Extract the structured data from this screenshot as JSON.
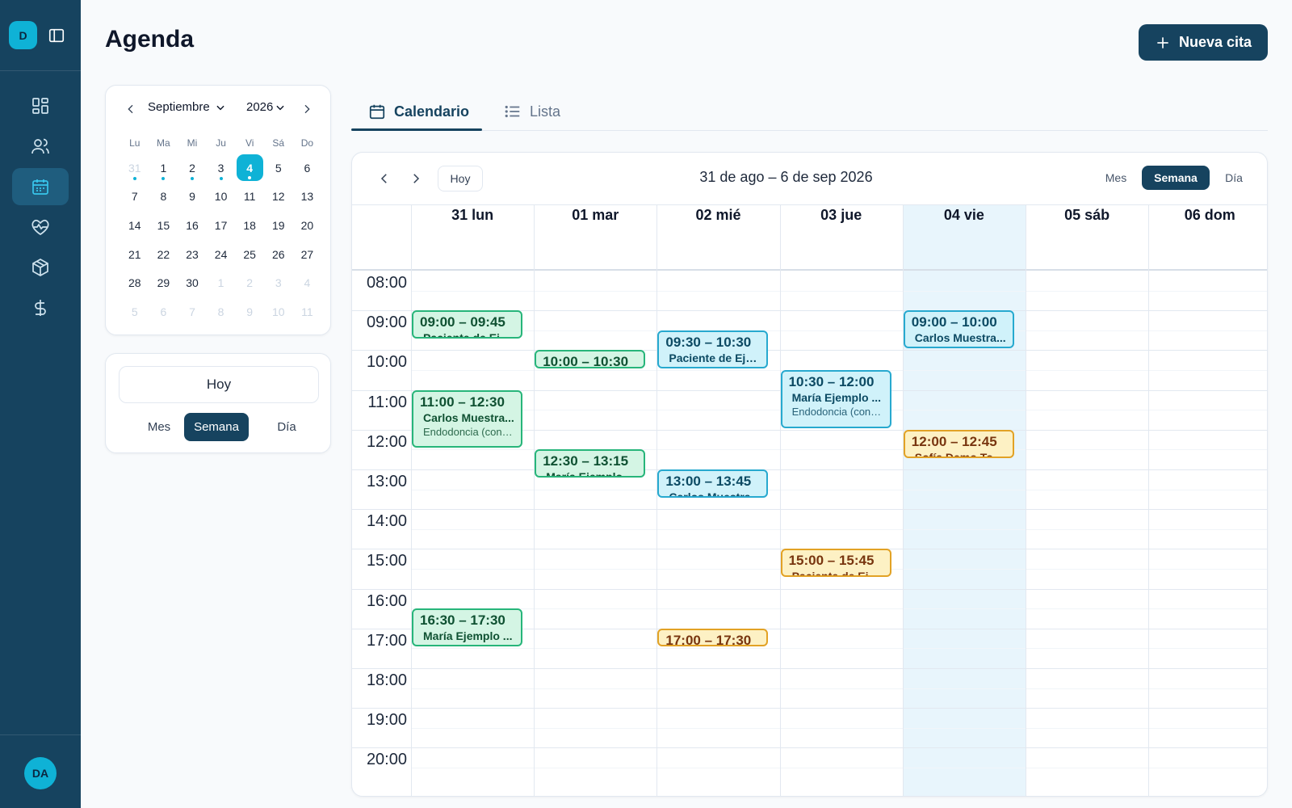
{
  "sidebar": {
    "workspace_initial": "D",
    "user_initials": "DA",
    "nav": [
      {
        "icon": "dashboard-icon",
        "active": false
      },
      {
        "icon": "users-icon",
        "active": false
      },
      {
        "icon": "calendar-icon",
        "active": true
      },
      {
        "icon": "heart-pulse-icon",
        "active": false
      },
      {
        "icon": "box-icon",
        "active": false
      },
      {
        "icon": "dollar-icon",
        "active": false
      }
    ]
  },
  "header": {
    "title": "Agenda",
    "new_button": "Nueva cita"
  },
  "mini_calendar": {
    "month": "Septiembre",
    "year": "2026",
    "weekdays": [
      "Lu",
      "Ma",
      "Mi",
      "Ju",
      "Vi",
      "Sá",
      "Do"
    ],
    "days": [
      {
        "n": "31",
        "muted": true,
        "dot": true
      },
      {
        "n": "1",
        "dot": true
      },
      {
        "n": "2",
        "dot": true
      },
      {
        "n": "3",
        "dot": true
      },
      {
        "n": "4",
        "dot": true,
        "selected": true
      },
      {
        "n": "5"
      },
      {
        "n": "6"
      },
      {
        "n": "7"
      },
      {
        "n": "8"
      },
      {
        "n": "9"
      },
      {
        "n": "10"
      },
      {
        "n": "11"
      },
      {
        "n": "12"
      },
      {
        "n": "13"
      },
      {
        "n": "14"
      },
      {
        "n": "15"
      },
      {
        "n": "16"
      },
      {
        "n": "17"
      },
      {
        "n": "18"
      },
      {
        "n": "19"
      },
      {
        "n": "20"
      },
      {
        "n": "21"
      },
      {
        "n": "22"
      },
      {
        "n": "23"
      },
      {
        "n": "24"
      },
      {
        "n": "25"
      },
      {
        "n": "26"
      },
      {
        "n": "27"
      },
      {
        "n": "28"
      },
      {
        "n": "29"
      },
      {
        "n": "30"
      },
      {
        "n": "1",
        "muted": true
      },
      {
        "n": "2",
        "muted": true
      },
      {
        "n": "3",
        "muted": true
      },
      {
        "n": "4",
        "muted": true
      },
      {
        "n": "5",
        "muted": true
      },
      {
        "n": "6",
        "muted": true
      },
      {
        "n": "7",
        "muted": true
      },
      {
        "n": "8",
        "muted": true
      },
      {
        "n": "9",
        "muted": true
      },
      {
        "n": "10",
        "muted": true
      },
      {
        "n": "11",
        "muted": true
      }
    ]
  },
  "quick": {
    "today": "Hoy",
    "views": [
      "Mes",
      "Semana",
      "Día"
    ],
    "active_view": "Semana"
  },
  "tabs": [
    {
      "label": "Calendario",
      "active": true,
      "icon": "calendar-icon"
    },
    {
      "label": "Lista",
      "active": false,
      "icon": "list-icon"
    }
  ],
  "calendar": {
    "today_button": "Hoy",
    "range": "31 de ago – 6 de sep 2026",
    "views": [
      "Mes",
      "Semana",
      "Día"
    ],
    "active_view": "Semana",
    "days": [
      {
        "label": "31 lun"
      },
      {
        "label": "01 mar"
      },
      {
        "label": "02 mié"
      },
      {
        "label": "03 jue"
      },
      {
        "label": "04 vie",
        "today": true
      },
      {
        "label": "05 sáb"
      },
      {
        "label": "06 dom"
      }
    ],
    "hours": [
      "08:00",
      "09:00",
      "10:00",
      "11:00",
      "12:00",
      "13:00",
      "14:00",
      "15:00",
      "16:00",
      "17:00",
      "18:00",
      "19:00",
      "20:00"
    ],
    "colors": {
      "green": "#27b57a",
      "cyan": "#27a9cf",
      "amber": "#e2a225"
    },
    "events": [
      {
        "day": 0,
        "start": "09:00",
        "end": "09:45",
        "time": "09:00 – 09:45",
        "patient": "Paciente de Eje...",
        "color": "green"
      },
      {
        "day": 0,
        "start": "11:00",
        "end": "12:30",
        "time": "11:00 – 12:30",
        "patient": "Carlos Muestra...",
        "service": "Endodoncia (cond...",
        "color": "green"
      },
      {
        "day": 0,
        "start": "16:30",
        "end": "17:30",
        "time": "16:30 – 17:30",
        "patient": "María Ejemplo ...",
        "color": "green"
      },
      {
        "day": 1,
        "start": "10:00",
        "end": "10:30",
        "time": "10:00 – 10:30",
        "color": "green"
      },
      {
        "day": 1,
        "start": "12:30",
        "end": "13:15",
        "time": "12:30 – 13:15",
        "patient": "María Ejemplo...",
        "color": "green"
      },
      {
        "day": 2,
        "start": "09:30",
        "end": "10:30",
        "time": "09:30 – 10:30",
        "patient": "Paciente de Eje...",
        "color": "cyan"
      },
      {
        "day": 2,
        "start": "13:00",
        "end": "13:45",
        "time": "13:00 – 13:45",
        "patient": "Carlos Muestra...",
        "color": "cyan"
      },
      {
        "day": 2,
        "start": "17:00",
        "end": "17:30",
        "time": "17:00 – 17:30",
        "color": "amber"
      },
      {
        "day": 3,
        "start": "10:30",
        "end": "12:00",
        "time": "10:30 – 12:00",
        "patient": "María Ejemplo ...",
        "service": "Endodoncia (cond...",
        "color": "cyan"
      },
      {
        "day": 3,
        "start": "15:00",
        "end": "15:45",
        "time": "15:00 – 15:45",
        "patient": "Paciente de Eje...",
        "color": "amber"
      },
      {
        "day": 4,
        "start": "09:00",
        "end": "10:00",
        "time": "09:00 – 10:00",
        "patient": "Carlos Muestra...",
        "color": "cyan"
      },
      {
        "day": 4,
        "start": "12:00",
        "end": "12:45",
        "time": "12:00 – 12:45",
        "patient": "Sofía Demo Tor...",
        "color": "amber"
      }
    ]
  }
}
